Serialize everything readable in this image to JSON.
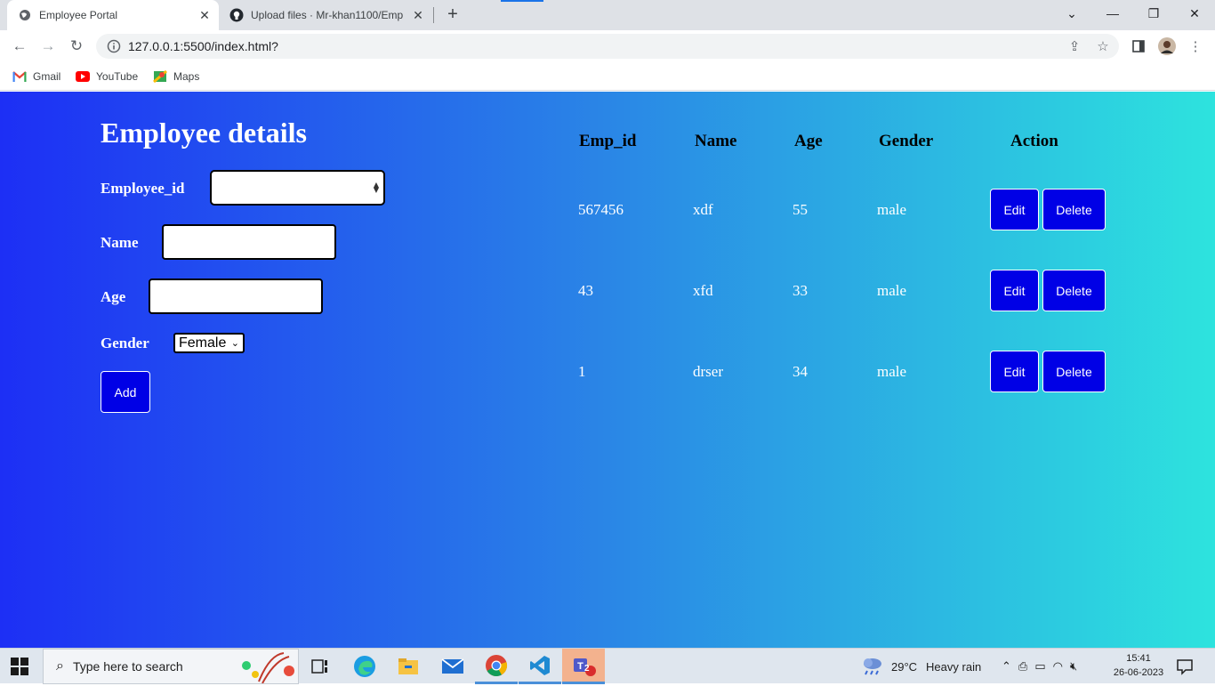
{
  "browser": {
    "tabs": [
      {
        "title": "Employee Portal"
      },
      {
        "title": "Upload files · Mr-khan1100/Emp..."
      }
    ],
    "address": "127.0.0.1:5500/index.html?",
    "bookmarks": [
      {
        "label": "Gmail",
        "icon": "gmail-icon"
      },
      {
        "label": "YouTube",
        "icon": "youtube-icon"
      },
      {
        "label": "Maps",
        "icon": "maps-icon"
      }
    ]
  },
  "form": {
    "title": "Employee details",
    "employee_id_label": "Employee_id",
    "employee_id_value": "",
    "name_label": "Name",
    "name_value": "",
    "age_label": "Age",
    "age_value": "",
    "gender_label": "Gender",
    "gender_selected": "Female",
    "add_label": "Add"
  },
  "table": {
    "headers": [
      "Emp_id",
      "Name",
      "Age",
      "Gender",
      "Action"
    ],
    "rows": [
      {
        "emp_id": "567456",
        "name": "xdf",
        "age": "55",
        "gender": "male"
      },
      {
        "emp_id": "43",
        "name": "xfd",
        "age": "33",
        "gender": "male"
      },
      {
        "emp_id": "1",
        "name": "drser",
        "age": "34",
        "gender": "male"
      }
    ],
    "edit_label": "Edit",
    "delete_label": "Delete"
  },
  "taskbar": {
    "search_placeholder": "Type here to search",
    "weather_temp": "29°C",
    "weather_text": "Heavy rain",
    "time": "15:41",
    "date": "26-06-2023",
    "teams_badge": "2"
  },
  "colors": {
    "gradient_start": "#1d2ff5",
    "gradient_end": "#2de3de",
    "button_blue": "#0000e6"
  }
}
